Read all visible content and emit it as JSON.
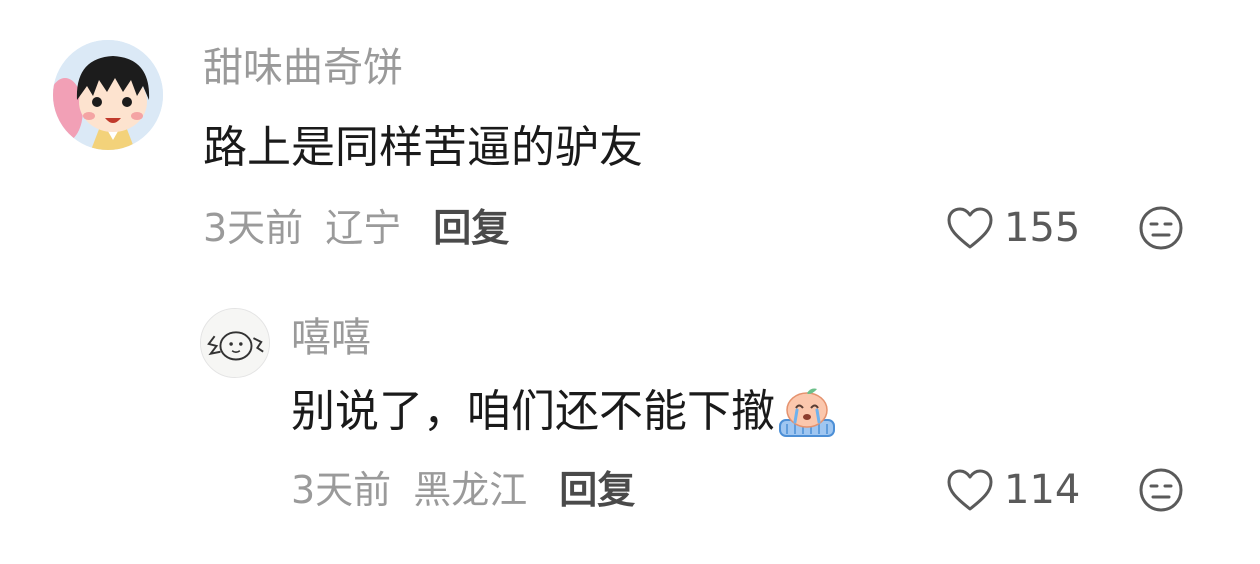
{
  "comments": [
    {
      "username": "甜味曲奇饼",
      "text": "路上是同样苦逼的驴友",
      "time": "3天前",
      "location": "辽宁",
      "reply_label": "回复",
      "like_count": "155",
      "icons": {
        "like": "heart-outline-icon",
        "dislike": "meh-face-icon"
      }
    },
    {
      "username": "嘻嘻",
      "text": "别说了，咱们还不能下撤",
      "emoji": "crying-peach-emoji",
      "time": "3天前",
      "location": "黑龙江",
      "reply_label": "回复",
      "like_count": "114",
      "icons": {
        "like": "heart-outline-icon",
        "dislike": "meh-face-icon"
      }
    }
  ],
  "colors": {
    "secondary_text": "#9a9a9a",
    "primary_text": "#1a1a1a",
    "reply_text": "#4a4a4a"
  }
}
